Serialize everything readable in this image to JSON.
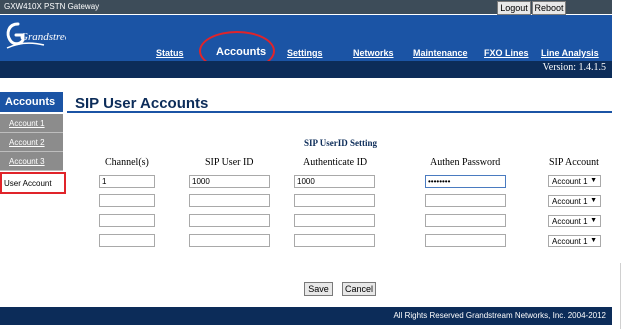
{
  "window": {
    "title": "GXW410X PSTN Gateway",
    "logout_label": "Logout",
    "reboot_label": "Reboot"
  },
  "header": {
    "brand": "Grandstream",
    "version": "Version: 1.4.1.5",
    "nav": [
      {
        "label": "Status"
      },
      {
        "label": "Accounts",
        "active": true
      },
      {
        "label": "Settings"
      },
      {
        "label": "Networks"
      },
      {
        "label": "Maintenance"
      },
      {
        "label": "FXO Lines"
      },
      {
        "label": "Line Analysis"
      }
    ]
  },
  "sidebar": {
    "section": "Accounts",
    "items": [
      {
        "label": "Account 1"
      },
      {
        "label": "Account 2"
      },
      {
        "label": "Account 3"
      },
      {
        "label": "User Account",
        "selected": true
      }
    ]
  },
  "main": {
    "title": "SIP User Accounts",
    "section_title": "SIP UserID Setting",
    "columns": [
      "Channel(s)",
      "SIP User ID",
      "Authenticate ID",
      "Authen Password",
      "SIP Account"
    ],
    "rows": [
      {
        "channels": "1",
        "sip_user_id": "1000",
        "authenticate_id": "1000",
        "password": "••••••••",
        "sip_account": "Account 1"
      },
      {
        "channels": "",
        "sip_user_id": "",
        "authenticate_id": "",
        "password": "",
        "sip_account": "Account 1"
      },
      {
        "channels": "",
        "sip_user_id": "",
        "authenticate_id": "",
        "password": "",
        "sip_account": "Account 1"
      },
      {
        "channels": "",
        "sip_user_id": "",
        "authenticate_id": "",
        "password": "",
        "sip_account": "Account 1"
      }
    ],
    "save_label": "Save",
    "cancel_label": "Cancel"
  },
  "footer": {
    "copyright": "All Rights Reserved Grandstream Networks, Inc. 2004-2012"
  },
  "colors": {
    "header_blue": "#1b54a5",
    "dark_navy": "#0c2c59",
    "annotation_red": "#e0242a",
    "sidebar_gray": "#8c8c8c"
  }
}
